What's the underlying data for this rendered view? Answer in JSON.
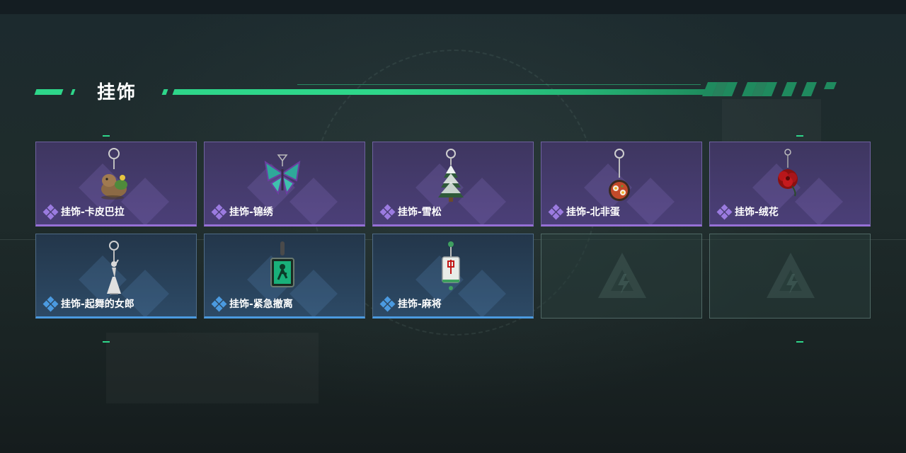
{
  "section_title": "挂饰",
  "cards": [
    {
      "label": "挂饰-卡皮巴拉",
      "rarity": "purple",
      "icon": "capybara-charm-icon"
    },
    {
      "label": "挂饰-锦绣",
      "rarity": "purple",
      "icon": "butterfly-charm-icon"
    },
    {
      "label": "挂饰-雪松",
      "rarity": "purple",
      "icon": "snow-pine-charm-icon"
    },
    {
      "label": "挂饰-北非蛋",
      "rarity": "purple",
      "icon": "shakshuka-pan-charm-icon"
    },
    {
      "label": "挂饰-绒花",
      "rarity": "purple",
      "icon": "red-rose-charm-icon"
    },
    {
      "label": "挂饰-起舞的女郎",
      "rarity": "blue",
      "icon": "dancing-lady-charm-icon"
    },
    {
      "label": "挂饰-紧急撤离",
      "rarity": "blue",
      "icon": "emergency-exit-charm-icon"
    },
    {
      "label": "挂饰-麻将",
      "rarity": "blue",
      "icon": "mahjong-tile-charm-icon"
    },
    {
      "label": "",
      "rarity": "empty",
      "icon": "empty-slot-logo-icon"
    },
    {
      "label": "",
      "rarity": "empty",
      "icon": "empty-slot-logo-icon"
    }
  ],
  "colors": {
    "accent": "#2ed68a",
    "purple_rarity": "#9670d6",
    "blue_rarity": "#4b9ae0"
  }
}
